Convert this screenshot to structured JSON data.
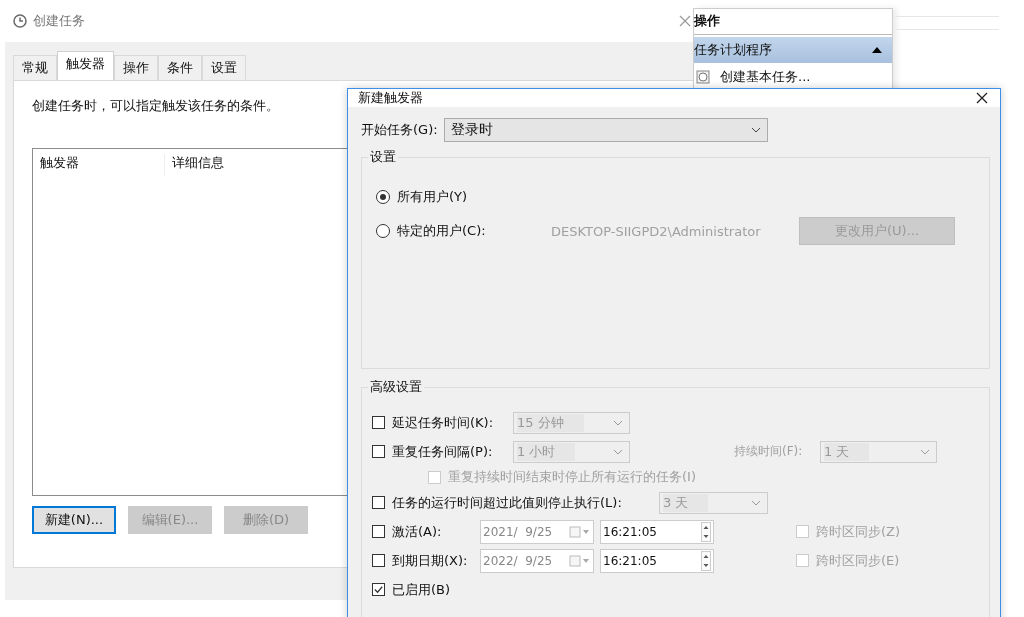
{
  "task_window": {
    "title": "创建任务",
    "tabs": [
      {
        "label": "常规",
        "selected": false
      },
      {
        "label": "触发器",
        "selected": true
      },
      {
        "label": "操作",
        "selected": false
      },
      {
        "label": "条件",
        "selected": false
      },
      {
        "label": "设置",
        "selected": false
      }
    ],
    "description": "创建任务时，可以指定触发该任务的条件。",
    "columns": [
      "触发器",
      "详细信息"
    ],
    "buttons": [
      {
        "label": "新建(N)...",
        "disabled": false
      },
      {
        "label": "编辑(E)...",
        "disabled": true
      },
      {
        "label": "删除(D)",
        "disabled": true
      }
    ]
  },
  "actions_panel": {
    "header": "操作",
    "section": "任务计划程序",
    "items": [
      "创建基本任务..."
    ]
  },
  "trigger_dialog": {
    "title": "新建触发器",
    "begin_label": "开始任务(G):",
    "begin_value": "登录时",
    "settings_title": "设置",
    "user_options": [
      {
        "label": "所有用户(Y)",
        "selected": true
      },
      {
        "label": "特定的用户(C):",
        "selected": false
      }
    ],
    "user_name": "DESKTOP-SIIGPD2\\Administrator",
    "change_user_button": {
      "label": "更改用户(U)...",
      "disabled": true
    },
    "advanced_title": "高级设置",
    "advanced_rows": [
      {
        "kind": "dropdown",
        "label": "延迟任务时间(K):",
        "checked": false,
        "value": "15 分钟"
      },
      {
        "kind": "repeat",
        "label": "重复任务间隔(P):",
        "checked": false,
        "value": "1 小时",
        "duration_label": "持续时间(F):",
        "duration_value": "1 天"
      },
      {
        "kind": "subcheck",
        "label": "重复持续时间结束时停止所有运行的任务(I)",
        "checked": false,
        "disabled": true
      },
      {
        "kind": "longdropdown",
        "label": "任务的运行时间超过此值则停止执行(L):",
        "checked": false,
        "value": "3 天"
      },
      {
        "kind": "datetime",
        "label": "激活(A):",
        "checked": false,
        "date": "2021/  9/25",
        "time": "16:21:05",
        "sync_label": "跨时区同步(Z)",
        "sync_checked": false
      },
      {
        "kind": "datetime",
        "label": "到期日期(X):",
        "checked": false,
        "date": "2022/  9/25",
        "time": "16:21:05",
        "sync_label": "跨时区同步(E)",
        "sync_checked": false
      },
      {
        "kind": "check",
        "label": "已启用(B)",
        "checked": true
      }
    ]
  }
}
